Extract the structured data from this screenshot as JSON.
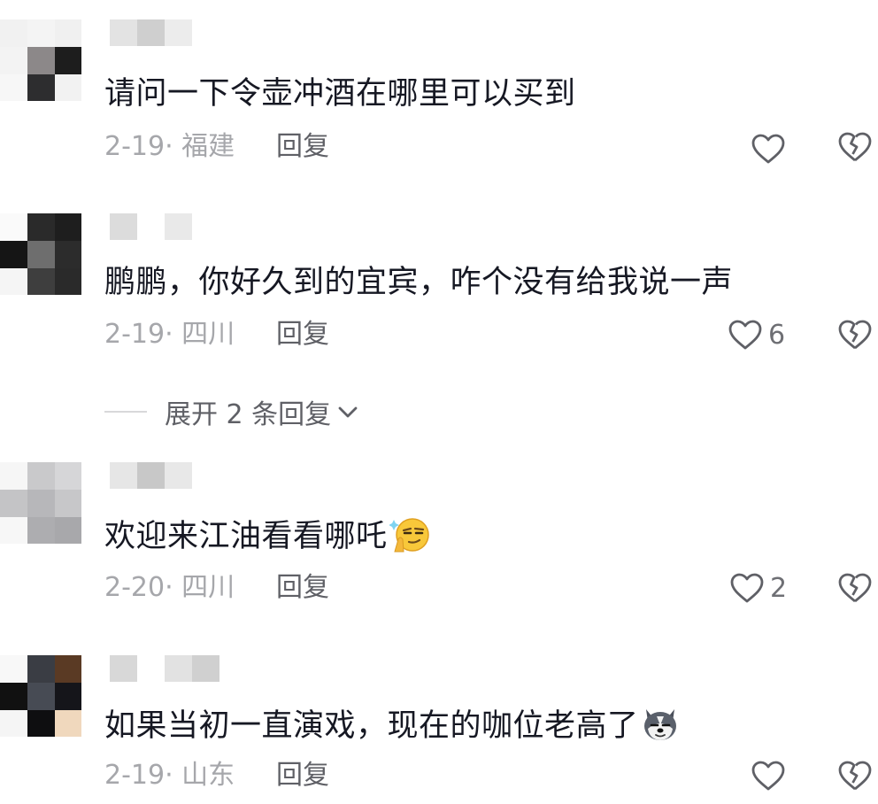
{
  "comments": [
    {
      "text": "请问一下令壶冲酒在哪里可以买到",
      "date": "2-19",
      "location": "福建",
      "reply_label": "回复",
      "likes": ""
    },
    {
      "text": "鹏鹏，你好久到的宜宾，咋个没有给我说一声",
      "date": "2-19",
      "location": "四川",
      "reply_label": "回复",
      "likes": "6"
    },
    {
      "text": "欢迎来江油看看哪吒",
      "date": "2-20",
      "location": "四川",
      "reply_label": "回复",
      "likes": "2",
      "emoji": "thinking-smirk-emoji"
    },
    {
      "text": "如果当初一直演戏，现在的咖位老高了",
      "date": "2-19",
      "location": "山东",
      "reply_label": "回复",
      "likes": "",
      "emoji": "husky-dog-emoji"
    }
  ],
  "expand_replies": {
    "label": "展开 2 条回复"
  },
  "colors": {
    "text": "#161823",
    "meta": "#a6a7ab",
    "reply": "#5f6066",
    "icon": "#5f6066"
  }
}
